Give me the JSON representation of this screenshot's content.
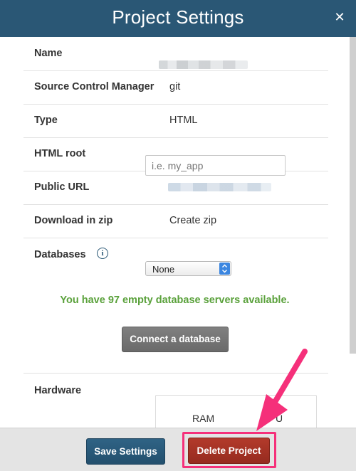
{
  "dialog": {
    "title": "Project Settings",
    "close_glyph": "✕"
  },
  "rows": {
    "name": {
      "label": "Name",
      "value": ""
    },
    "scm": {
      "label": "Source Control Manager",
      "value": "git"
    },
    "type": {
      "label": "Type",
      "value": "HTML"
    },
    "html_root": {
      "label": "HTML root",
      "placeholder": "i.e. my_app",
      "value": ""
    },
    "public_url": {
      "label": "Public URL",
      "value": ""
    },
    "download": {
      "label": "Download in zip",
      "value": "Create zip"
    },
    "databases": {
      "label": "Databases",
      "info_glyph": "i",
      "selected": "None",
      "options": [
        "None"
      ]
    }
  },
  "availability_message": "You have 97 empty database servers available.",
  "connect_button": "Connect a database",
  "hardware": {
    "label": "Hardware",
    "ram_label": "RAM",
    "partial_label": "U"
  },
  "footer": {
    "save_label": "Save Settings",
    "delete_label": "Delete Project"
  },
  "colors": {
    "header_bg": "#2a5775",
    "success_text": "#5aa13b",
    "delete_button": "#a83325",
    "annotation": "#f5307a"
  },
  "icons": [
    "close-icon",
    "info-icon",
    "stepper-icon",
    "annotation-arrow"
  ]
}
